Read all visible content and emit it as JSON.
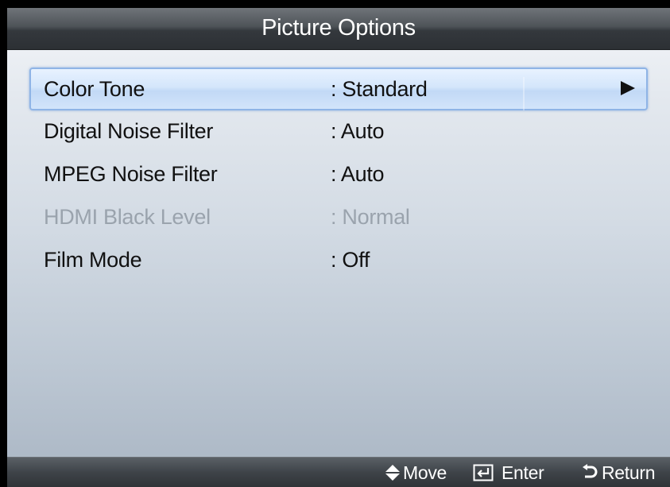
{
  "window": {
    "title": "Picture Options"
  },
  "menu": {
    "items": [
      {
        "label": "Color Tone",
        "value": ": Standard",
        "selected": true,
        "enabled": true
      },
      {
        "label": "Digital Noise Filter",
        "value": ": Auto",
        "selected": false,
        "enabled": true
      },
      {
        "label": "MPEG Noise Filter",
        "value": ": Auto",
        "selected": false,
        "enabled": true
      },
      {
        "label": "HDMI Black Level",
        "value": ": Normal",
        "selected": false,
        "enabled": false
      },
      {
        "label": "Film Mode",
        "value": ": Off",
        "selected": false,
        "enabled": true
      }
    ],
    "submenu_indicator_icon": "right-triangle-icon"
  },
  "footer": {
    "move_label": "Move",
    "move_icon": "up-down-arrows-icon",
    "enter_label": "Enter",
    "enter_icon": "enter-key-icon",
    "return_label": "Return",
    "return_icon": "return-arrow-icon"
  },
  "colors": {
    "selection_highlight": "#c2d9f6",
    "selection_border": "#8fb4e6",
    "disabled_text": "#9aa3ad",
    "bar_dark": "#2c3034"
  }
}
